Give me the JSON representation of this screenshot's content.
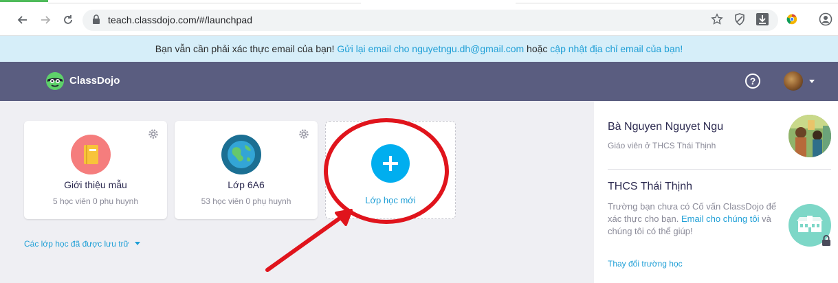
{
  "browser": {
    "url": "teach.classdojo.com/#/launchpad",
    "icons": [
      "back-arrow-icon",
      "forward-arrow-icon",
      "reload-icon",
      "lock-icon",
      "star-icon",
      "shield-icon",
      "download-icon",
      "chrome-extension-icon",
      "profile-icon"
    ]
  },
  "banner": {
    "text1": "Bạn vẫn cần phải xác thực email của bạn! ",
    "link1": "Gửi lại email cho nguyetngu.dh@gmail.com",
    "text2": " hoặc ",
    "link2": "cập nhật địa chỉ email của bạn!"
  },
  "header": {
    "brand": "ClassDojo",
    "help_symbol": "?",
    "colors": {
      "bar": "#5a5d80"
    }
  },
  "classes": [
    {
      "name": "Giới thiệu mẫu",
      "meta": "5 học viên 0 phụ huynh",
      "icon": "book-icon",
      "color": "#f57d7d"
    },
    {
      "name": "Lớp 6A6",
      "meta": "53 học viên 0 phụ huynh",
      "icon": "globe-icon",
      "color": "#1b6f93"
    }
  ],
  "new_class": {
    "label": "Lớp học mới",
    "color": "#00aeef"
  },
  "archived_link": "Các lớp học đã được lưu trữ",
  "profile": {
    "name": "Bà Nguyen Nguyet Ngu",
    "role": "Giáo viên ở THCS Thái Thịnh"
  },
  "school": {
    "title": "THCS Thái Thịnh",
    "desc_part1": "Trường bạn chưa có Cố vấn ClassDojo để xác thực cho bạn.",
    "desc_link": "Email cho chúng tôi",
    "desc_part2": " và chúng tôi có thể giúp!",
    "change_link": "Thay đổi trường học"
  },
  "annotation_color": "#e0141c"
}
